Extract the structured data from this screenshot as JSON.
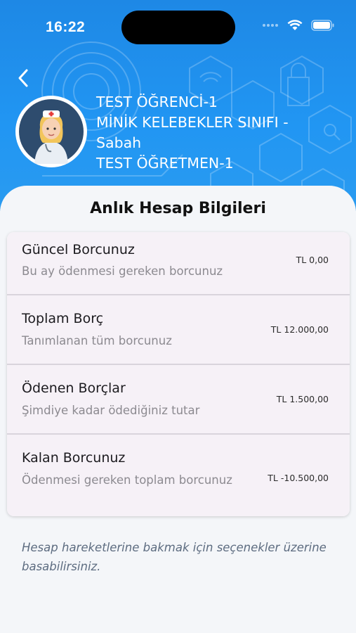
{
  "status_bar": {
    "time": "16:22"
  },
  "profile": {
    "student_name": "TEST ÖĞRENCİ-1",
    "class_line1": "MİNİK KELEBEKLER SINIFI -",
    "class_line2": "Sabah",
    "teacher_name": "TEST ÖĞRETMEN-1"
  },
  "page_title": "Anlık Hesap Bilgileri",
  "accounts": [
    {
      "title": "Güncel Borcunuz",
      "subtitle": "Bu ay ödenmesi gereken borcunuz",
      "amount": "TL 0,00"
    },
    {
      "title": "Toplam Borç",
      "subtitle": "Tanımlanan tüm borcunuz",
      "amount": "TL 12.000,00"
    },
    {
      "title": "Ödenen Borçlar",
      "subtitle": "Şimdiye kadar ödediğiniz tutar",
      "amount": "TL 1.500,00"
    },
    {
      "title": "Kalan Borcunuz",
      "subtitle": "Ödenmesi gereken toplam borcunuz",
      "amount": "TL -10.500,00"
    }
  ],
  "hint_text": "Hesap hareketlerine bakmak için seçenekler üzerine basabilirsiniz.",
  "colors": {
    "header": "#2196f3",
    "row_bg": "#f6f1f7",
    "page_bg": "#f4f6f9"
  },
  "icons": {
    "back": "chevron-left-icon",
    "wifi": "wifi-icon",
    "battery": "battery-icon",
    "signal": "signal-icon"
  }
}
